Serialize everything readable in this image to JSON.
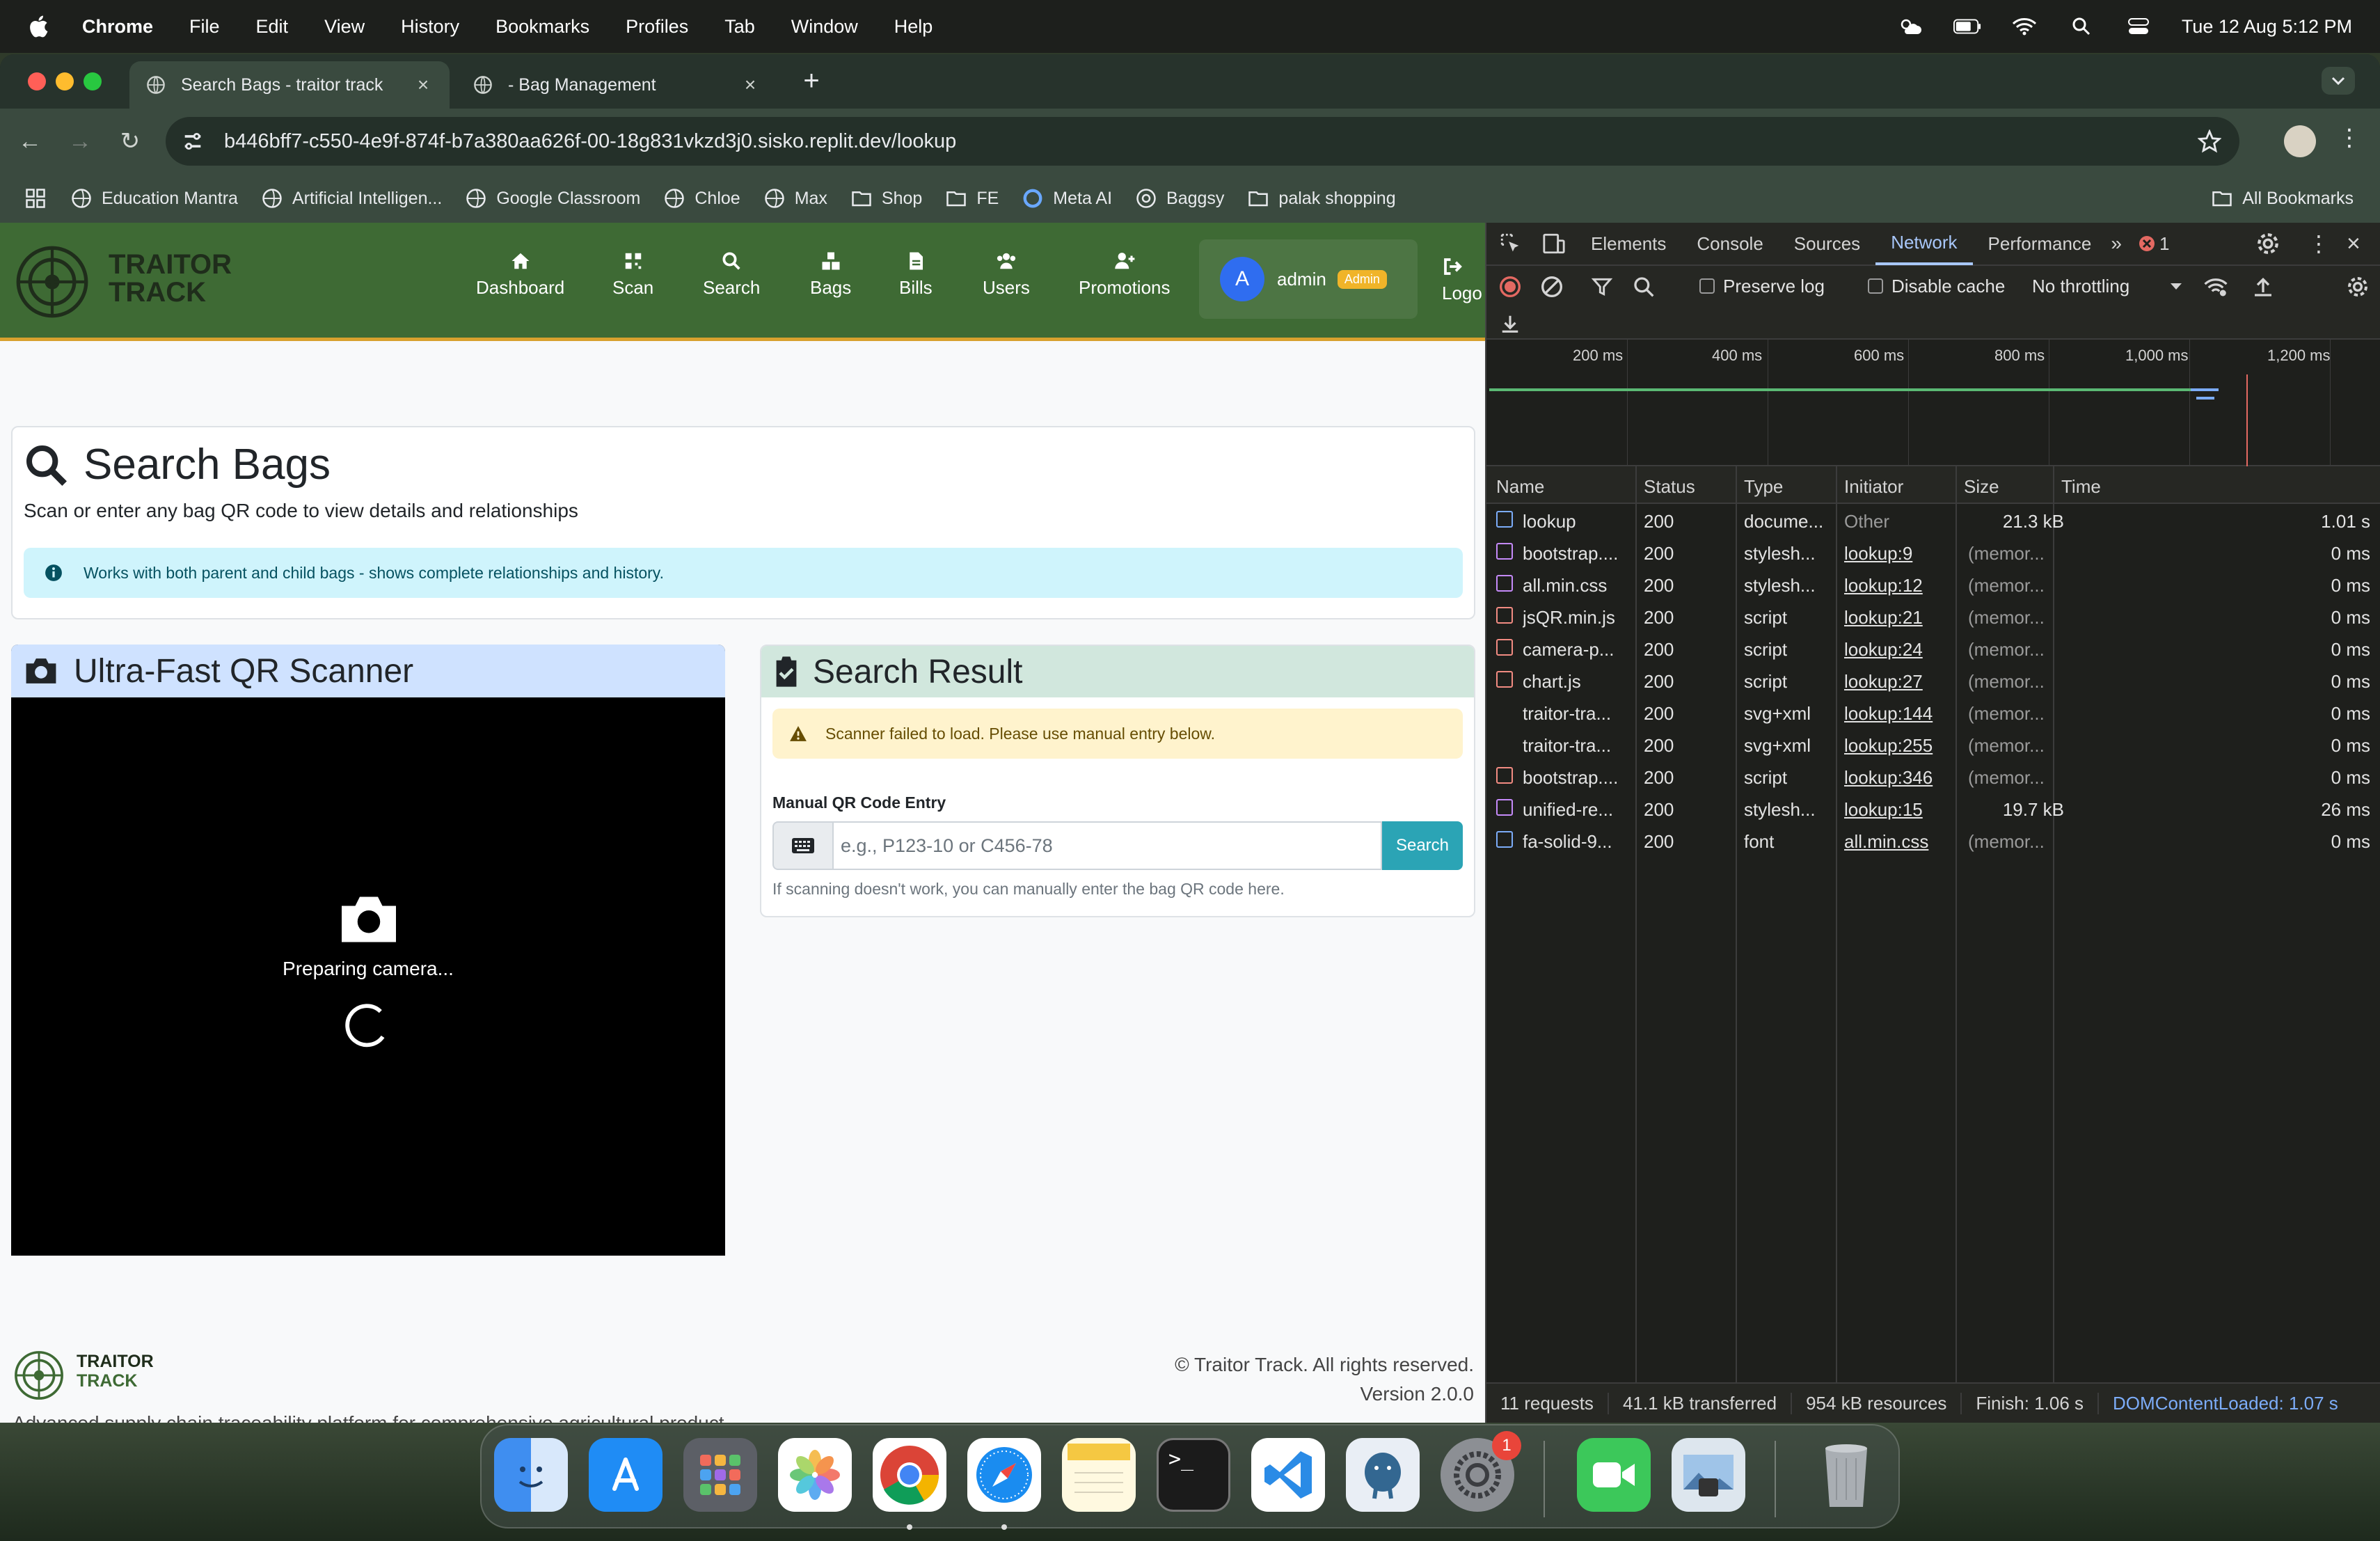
{
  "menubar": {
    "app": "Chrome",
    "items": [
      "File",
      "Edit",
      "View",
      "History",
      "Bookmarks",
      "Profiles",
      "Tab",
      "Window",
      "Help"
    ],
    "clock": "Tue 12 Aug  5:12 PM"
  },
  "tabs": [
    {
      "title": "Search Bags - traitor track"
    },
    {
      "title": "- Bag Management"
    }
  ],
  "omnibox": {
    "url": "b446bff7-c550-4e9f-874f-b7a380aa626f-00-18g831vkzd3j0.sisko.replit.dev/lookup"
  },
  "bookmarks": [
    "Education Mantra",
    "Artificial Intelligen...",
    "Google Classroom",
    "Chloe",
    "Max",
    "Shop",
    "FE",
    "Meta AI",
    "Baggsy",
    "palak shopping"
  ],
  "all_bookmarks": "All Bookmarks",
  "app": {
    "brand_line1": "TRAITOR",
    "brand_line2": "TRACK",
    "nav": [
      "Dashboard",
      "Scan",
      "Search",
      "Bags",
      "Bills",
      "Users",
      "Promotions"
    ],
    "avatar_letter": "A",
    "user_name": "admin",
    "user_badge": "Admin",
    "logout": "Logo"
  },
  "search_page": {
    "title": "Search Bags",
    "subtitle": "Scan or enter any bag QR code to view details and relationships",
    "info": "Works with both parent and child bags - shows complete relationships and history."
  },
  "scanner": {
    "title": "Ultra-Fast QR Scanner",
    "status": "Preparing camera..."
  },
  "result": {
    "title": "Search Result",
    "warning": "Scanner failed to load. Please use manual entry below.",
    "manual_label": "Manual QR Code Entry",
    "input_placeholder": "e.g., P123-10 or C456-78",
    "input_value": "",
    "search_button": "Search",
    "help": "If scanning doesn't work, you can manually enter the bag QR code here."
  },
  "footer": {
    "brand_line1": "TRAITOR",
    "brand_line2": "TRACK",
    "description": "Advanced supply chain traceability platform for comprehensive agricultural product tracking.",
    "copyright": "© Traitor Track. All rights reserved.",
    "version": "Version 2.0.0"
  },
  "devtools": {
    "tabs": [
      "Elements",
      "Console",
      "Sources",
      "Network",
      "Performance"
    ],
    "active_tab": "Network",
    "error_count": "1",
    "preserve_log": "Preserve log",
    "disable_cache": "Disable cache",
    "throttling": "No throttling",
    "ticks": [
      "200 ms",
      "400 ms",
      "600 ms",
      "800 ms",
      "1,000 ms",
      "1,200 ms"
    ],
    "columns": [
      "Name",
      "Status",
      "Type",
      "Initiator",
      "Size",
      "Time"
    ],
    "rows": [
      {
        "name": "lookup",
        "status": "200",
        "type": "docume...",
        "initiator": "Other",
        "size": "21.3 kB",
        "time": "1.01 s",
        "kind": "doc"
      },
      {
        "name": "bootstrap....",
        "status": "200",
        "type": "stylesh...",
        "initiator": "lookup:9",
        "size": "(memor...",
        "time": "0 ms",
        "kind": "css"
      },
      {
        "name": "all.min.css",
        "status": "200",
        "type": "stylesh...",
        "initiator": "lookup:12",
        "size": "(memor...",
        "time": "0 ms",
        "kind": "css"
      },
      {
        "name": "jsQR.min.js",
        "status": "200",
        "type": "script",
        "initiator": "lookup:21",
        "size": "(memor...",
        "time": "0 ms",
        "kind": "js"
      },
      {
        "name": "camera-p...",
        "status": "200",
        "type": "script",
        "initiator": "lookup:24",
        "size": "(memor...",
        "time": "0 ms",
        "kind": "js"
      },
      {
        "name": "chart.js",
        "status": "200",
        "type": "script",
        "initiator": "lookup:27",
        "size": "(memor...",
        "time": "0 ms",
        "kind": "js"
      },
      {
        "name": "traitor-tra...",
        "status": "200",
        "type": "svg+xml",
        "initiator": "lookup:144",
        "size": "(memor...",
        "time": "0 ms",
        "kind": "img"
      },
      {
        "name": "traitor-tra...",
        "status": "200",
        "type": "svg+xml",
        "initiator": "lookup:255",
        "size": "(memor...",
        "time": "0 ms",
        "kind": "img"
      },
      {
        "name": "bootstrap....",
        "status": "200",
        "type": "script",
        "initiator": "lookup:346",
        "size": "(memor...",
        "time": "0 ms",
        "kind": "js"
      },
      {
        "name": "unified-re...",
        "status": "200",
        "type": "stylesh...",
        "initiator": "lookup:15",
        "size": "19.7 kB",
        "time": "26 ms",
        "kind": "css"
      },
      {
        "name": "fa-solid-9...",
        "status": "200",
        "type": "font",
        "initiator": "all.min.css",
        "size": "(memor...",
        "time": "0 ms",
        "kind": "font"
      }
    ],
    "status_bar": [
      "11 requests",
      "41.1 kB transferred",
      "954 kB resources",
      "Finish: 1.06 s",
      "DOMContentLoaded: 1.07 s"
    ]
  },
  "dock": {
    "apps": [
      "finder-icon",
      "app-store-icon",
      "launchpad-icon",
      "photos-icon",
      "chrome-icon",
      "safari-icon",
      "notes-icon",
      "terminal-icon",
      "vscode-icon",
      "postgres-icon",
      "settings-icon",
      "facetime-icon",
      "preview-icon",
      "trash-icon"
    ],
    "settings_badge": "1"
  }
}
